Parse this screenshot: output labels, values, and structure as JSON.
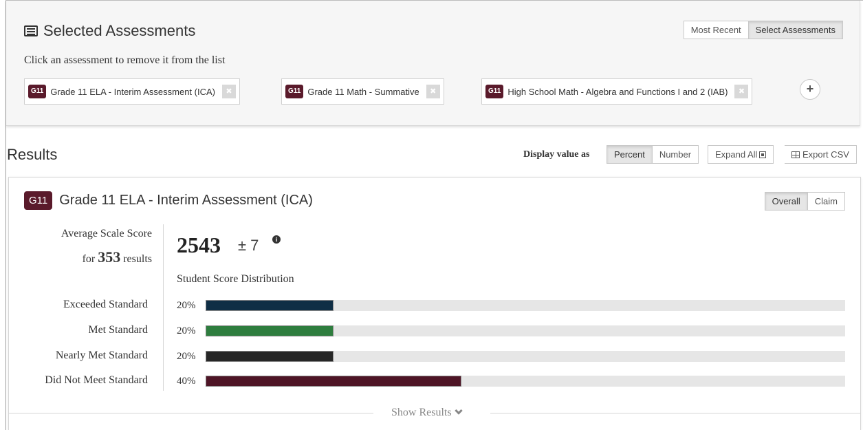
{
  "selected_panel": {
    "title": "Selected Assessments",
    "instructions": "Click an assessment to remove it from the list",
    "view_buttons": [
      "Most Recent",
      "Select Assessments"
    ],
    "view_active": "Select Assessments",
    "chips": [
      {
        "grade": "G11",
        "label": "Grade 11 ELA - Interim Assessment (ICA)"
      },
      {
        "grade": "G11",
        "label": "Grade 11 Math - Summative"
      },
      {
        "grade": "G11",
        "label": "High School Math - Algebra and Functions I and 2 (IAB)"
      }
    ],
    "add_label": "+"
  },
  "results": {
    "title": "Results",
    "display_label": "Display value as",
    "display_buttons": [
      "Percent",
      "Number"
    ],
    "display_active": "Percent",
    "expand_label": "Expand All",
    "export_label": "Export CSV"
  },
  "card": {
    "grade": "G11",
    "title": "Grade 11 ELA - Interim Assessment (ICA)",
    "view_buttons": [
      "Overall",
      "Claim"
    ],
    "view_active": "Overall",
    "avg_label": "Average Scale Score",
    "for_label": "for",
    "results_count": "353",
    "results_label": "results",
    "score": "2543",
    "score_margin": "± 7",
    "dist_title": "Student Score Distribution",
    "distribution": [
      {
        "label": "Exceeded Standard",
        "pct_label": "20%",
        "value": 0.2,
        "color": "#0f2e45"
      },
      {
        "label": "Met Standard",
        "pct_label": "20%",
        "value": 0.2,
        "color": "#2e7d3e"
      },
      {
        "label": "Nearly Met Standard",
        "pct_label": "20%",
        "value": 0.2,
        "color": "#262626"
      },
      {
        "label": "Did Not Meet Standard",
        "pct_label": "40%",
        "value": 0.4,
        "color": "#4e1526"
      }
    ],
    "show_results": "Show Results"
  },
  "icons": {
    "list": "list-icon",
    "info": "info-icon",
    "expand": "expand-square-icon",
    "table": "table-icon",
    "close": "close-icon",
    "chevron": "chevron-down-icon"
  }
}
